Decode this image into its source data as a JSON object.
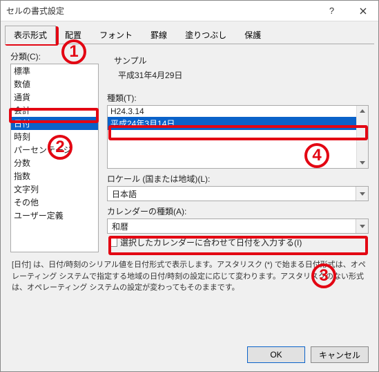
{
  "title": "セルの書式設定",
  "tabs": [
    "表示形式",
    "配置",
    "フォント",
    "罫線",
    "塗りつぶし",
    "保護"
  ],
  "category_label": "分類(C):",
  "categories": [
    "標準",
    "数値",
    "通貨",
    "会計",
    "日付",
    "時刻",
    "パーセンテージ",
    "分数",
    "指数",
    "文字列",
    "その他",
    "ユーザー定義"
  ],
  "selected_category_index": 4,
  "sample_label": "サンプル",
  "sample_value": "平成31年4月29日",
  "type_label": "種類(T):",
  "type_items": [
    "H24.3.14",
    "平成24年3月14日"
  ],
  "selected_type_index": 1,
  "locale_label": "ロケール (国または地域)(L):",
  "locale_value": "日本語",
  "calendar_label": "カレンダーの種類(A):",
  "calendar_value": "和暦",
  "checkbox_label": "選択したカレンダーに合わせて日付を入力する(I)",
  "description": "[日付] は、日付/時刻のシリアル値を日付形式で表示します。アスタリスク (*) で始まる日付形式は、オペレーティング システムで指定する地域の日付/時刻の設定に応じて変わります。アスタリスクのない形式は、オペレーティング システムの設定が変わってもそのままです。",
  "ok_label": "OK",
  "cancel_label": "キャンセル",
  "annotations": {
    "1": "1",
    "2": "2",
    "3": "3",
    "4": "4"
  }
}
